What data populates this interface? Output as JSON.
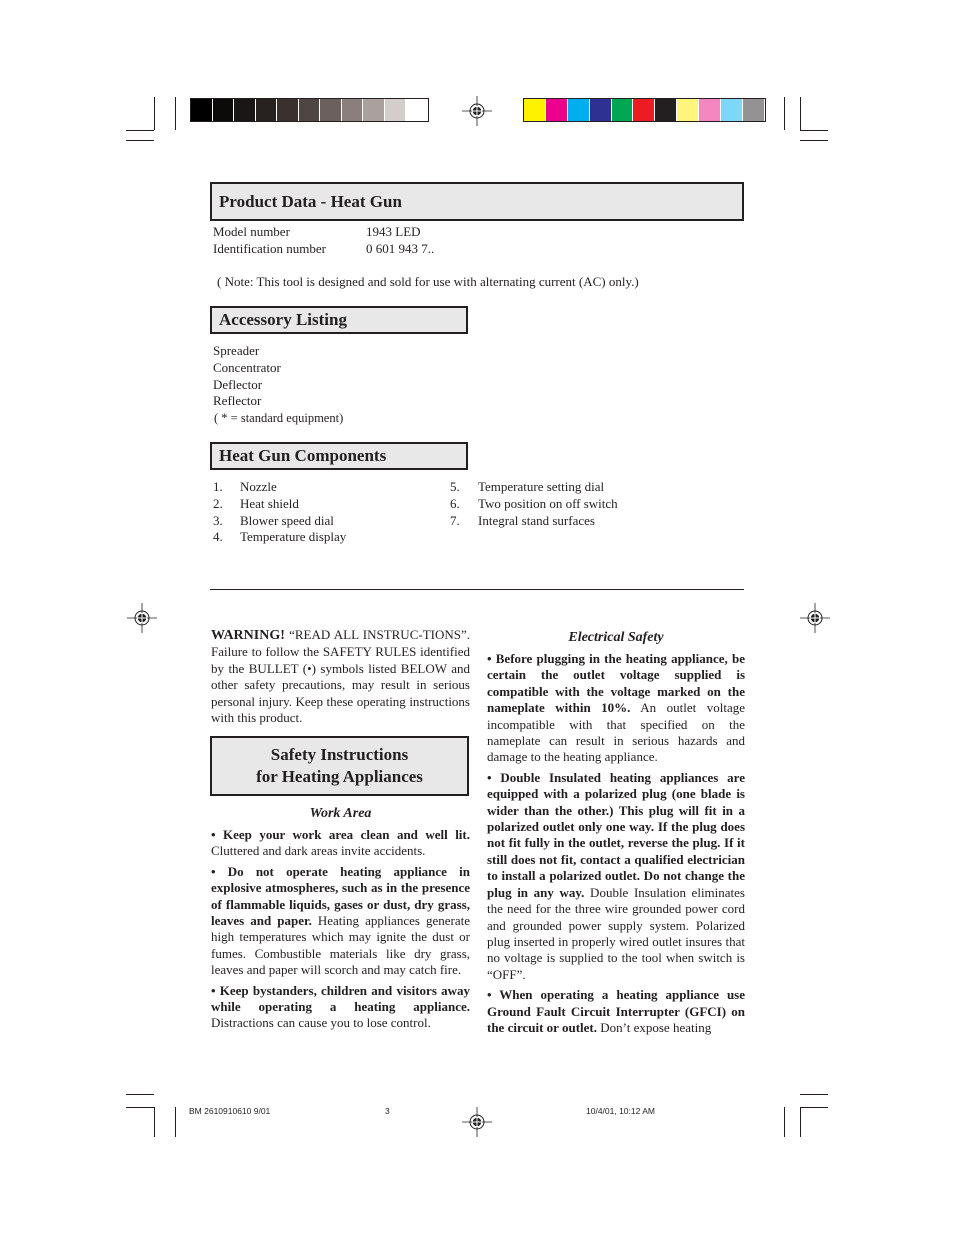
{
  "print_marks": {
    "grayscale_bar": [
      "#000000",
      "#0d0b0a",
      "#1a1615",
      "#272220",
      "#3a302d",
      "#4f4542",
      "#6b605d",
      "#8a7f7c",
      "#aaa19e",
      "#d5cdcb",
      "#ffffff"
    ],
    "color_bar": [
      "#fff200",
      "#ec008c",
      "#00aeef",
      "#2e3192",
      "#00a651",
      "#ed1c24",
      "#231f20",
      "#fff57d",
      "#f587c0",
      "#7dd8f8",
      "#939393"
    ]
  },
  "product_data": {
    "title": "Product Data -  Heat Gun",
    "rows": [
      {
        "label": "Model number",
        "value": "1943 LED"
      },
      {
        "label": "Identification number",
        "value": "0 601 943 7.."
      }
    ],
    "note": "( Note:  This tool is designed and sold for use with alternating current (AC) only.)"
  },
  "accessory_listing": {
    "title": "Accessory Listing",
    "items": [
      "Spreader",
      "Concentrator",
      "Deflector",
      "Reflector"
    ],
    "footnote": "( *  =  standard equipment)"
  },
  "components": {
    "title": "Heat Gun Components",
    "left": [
      {
        "num": "1.",
        "label": "Nozzle"
      },
      {
        "num": "2.",
        "label": "Heat shield"
      },
      {
        "num": "3.",
        "label": "Blower speed dial"
      },
      {
        "num": "4.",
        "label": "Temperature display"
      }
    ],
    "right": [
      {
        "num": "5.",
        "label": "Temperature setting dial"
      },
      {
        "num": "6.",
        "label": "Two position on off switch"
      },
      {
        "num": "7.",
        "label": "Integral stand surfaces"
      }
    ]
  },
  "warning": {
    "label": "WARNING!",
    "text": " “READ ALL INSTRUC-TIONS”. Failure to follow the SAFETY RULES identified by the BULLET (•) symbols listed BELOW and other safety precautions, may result in serious personal injury.   Keep these operating instructions with this product."
  },
  "safety_box": {
    "line1": "Safety Instructions",
    "line2": "for Heating Appliances"
  },
  "work_area": {
    "title": "Work Area",
    "items": [
      {
        "bold": "•  Keep your work area clean and well lit.",
        "text": " Cluttered and dark areas invite accidents."
      },
      {
        "bold": "•  Do not operate heating appliance in explosive atmospheres, such as in the presence of flammable liquids, gases or dust, dry grass, leaves and paper.",
        "text": " Heating appliances generate high temperatures which may ignite the dust or fumes. Combustible materials like dry grass, leaves and paper will scorch and may catch fire."
      },
      {
        "bold": "•  Keep bystanders, children and visitors away while operating a heating appliance.",
        "text": " Distractions can cause you to lose control."
      }
    ]
  },
  "electrical_safety": {
    "title": "Electrical Safety",
    "items": [
      {
        "bold": "•  Before plugging in the heating appliance, be certain the outlet voltage supplied is compatible with the voltage marked on the nameplate within 10%.",
        "text": " An outlet voltage incompatible with that specified on the nameplate can result in serious hazards and damage to the heating appliance."
      },
      {
        "bold": "•  Double Insulated heating appliances are equipped with a polarized plug (one blade is wider than the other.) This plug will fit in a polarized outlet only one way. If the plug does not fit fully in the outlet, reverse the plug. If it still does not fit, contact a qualified electrician to install a polarized outlet. Do not change the plug in any way.",
        "text": " Double Insulation  eliminates the need for the three wire grounded power cord and grounded power supply system. Polarized plug inserted in properly wired outlet insures that no voltage is supplied to the tool when switch is “OFF”."
      },
      {
        "bold": "•  When operating a heating appliance use Ground Fault Circuit Interrupter (GFCI) on the circuit or outlet.",
        "text": " Don’t expose heating"
      }
    ]
  },
  "footer": {
    "job": "BM 2610910610 9/01",
    "page": "3",
    "timestamp": "10/4/01, 10:12 AM"
  }
}
